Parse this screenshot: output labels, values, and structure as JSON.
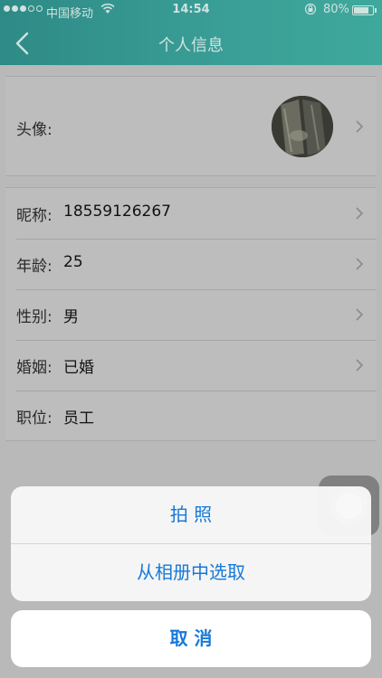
{
  "status_bar": {
    "carrier": "中国移动",
    "time": "14:54",
    "battery_percent": "80%",
    "battery_level": 0.8,
    "signal_strength": 3
  },
  "nav": {
    "title": "个人信息",
    "back_icon": "chevron-left-icon"
  },
  "avatar_row": {
    "label": "头像:"
  },
  "profile_rows": [
    {
      "label": "昵称:",
      "value": "18559126267",
      "has_chevron": true
    },
    {
      "label": "年龄:",
      "value": "25",
      "has_chevron": true
    },
    {
      "label": "性别:",
      "value": "男",
      "has_chevron": true
    },
    {
      "label": "婚姻:",
      "value": "已婚",
      "has_chevron": true
    },
    {
      "label": "职位:",
      "value": "员工",
      "has_chevron": false
    }
  ],
  "action_sheet": {
    "take_photo": "拍 照",
    "choose_from_album": "从相册中选取",
    "cancel": "取 消"
  },
  "colors": {
    "nav_gradient_start": "#2e8a86",
    "nav_gradient_end": "#3fa89c",
    "action_text": "#1779d8"
  }
}
